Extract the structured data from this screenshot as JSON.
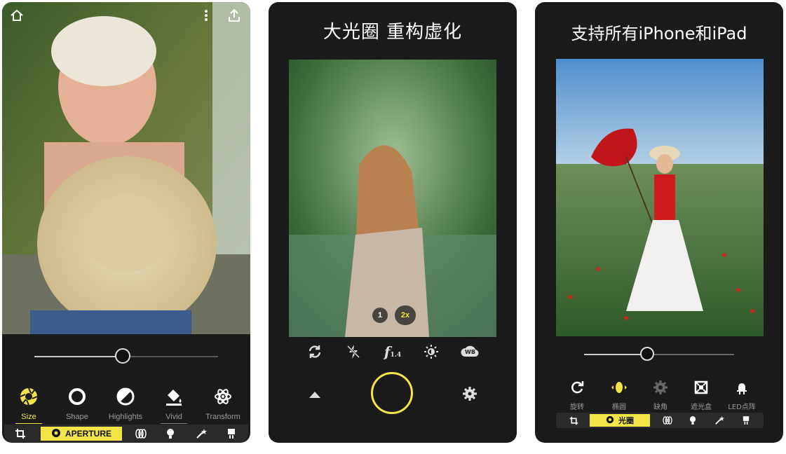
{
  "phone1": {
    "tools": [
      {
        "label": "Size",
        "icon": "aperture-icon",
        "active": true
      },
      {
        "label": "Shape",
        "icon": "circle-icon",
        "active": false
      },
      {
        "label": "Highlights",
        "icon": "highlights-icon",
        "active": false
      },
      {
        "label": "Vivid",
        "icon": "paint-bucket-icon",
        "active": false
      },
      {
        "label": "Transform",
        "icon": "atom-icon",
        "active": false
      }
    ],
    "slider_value": 0.48,
    "bottom_bar": {
      "active_label": "APERTURE"
    }
  },
  "phone2": {
    "title": "大光圈  重构虚化",
    "zoom_options": [
      "1",
      "2x"
    ],
    "aperture_label": "f",
    "aperture_sub": "1.4",
    "wb_label": "WB"
  },
  "phone3": {
    "title": "支持所有iPhone和iPad",
    "tools": [
      {
        "label": "旋转",
        "icon": "rotate-icon"
      },
      {
        "label": "椭圆",
        "icon": "ellipse-icon"
      },
      {
        "label": "缺角",
        "icon": "aperture-blades-icon"
      },
      {
        "label": "遮光盒",
        "icon": "light-box-icon"
      },
      {
        "label": "LED点阵",
        "icon": "led-icon"
      }
    ],
    "slider_value": 0.42,
    "bottom_bar": {
      "active_label": "光圈"
    }
  },
  "colors": {
    "accent": "#f3e44a",
    "panel": "#1b1b1c"
  }
}
